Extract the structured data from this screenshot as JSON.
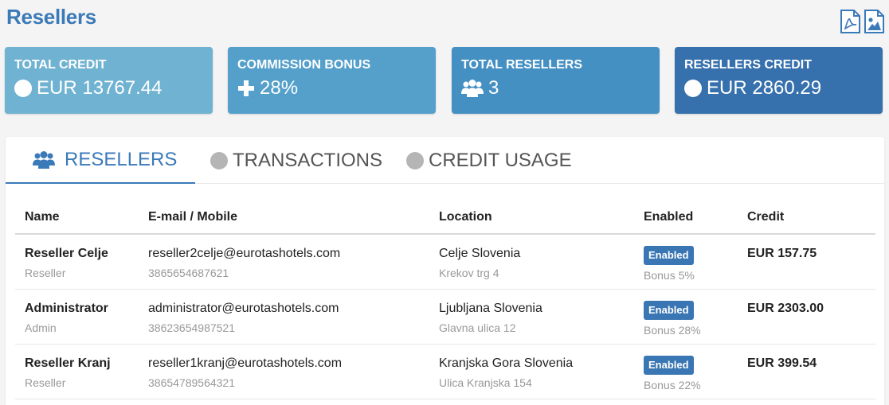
{
  "page": {
    "title": "Resellers"
  },
  "export": {
    "pdf_icon": "pdf-file-icon",
    "image_icon": "image-file-icon"
  },
  "colors": {
    "accent": "#3b7ab8",
    "badge": "#3a76b3",
    "muted": "#999999"
  },
  "cards": [
    {
      "title": "TOTAL CREDIT",
      "value": "EUR 13767.44",
      "icon": "circle-icon",
      "color": "#6fb2d2"
    },
    {
      "title": "COMMISSION BONUS",
      "value": "28%",
      "icon": "plus-icon",
      "color": "#55a0cb"
    },
    {
      "title": "TOTAL RESELLERS",
      "value": "3",
      "icon": "users-icon",
      "color": "#4590c3"
    },
    {
      "title": "RESELLERS CREDIT",
      "value": "EUR 2860.29",
      "icon": "circle-icon",
      "color": "#3670ad"
    }
  ],
  "tabs": [
    {
      "label": "RESELLERS",
      "icon": "users-icon",
      "active": true
    },
    {
      "label": "TRANSACTIONS",
      "icon": "circle-icon",
      "active": false
    },
    {
      "label": "CREDIT USAGE",
      "icon": "circle-icon",
      "active": false
    }
  ],
  "table": {
    "headers": [
      "Name",
      "E-mail / Mobile",
      "Location",
      "Enabled",
      "Credit"
    ],
    "rows": [
      {
        "name": "Reseller Celje",
        "role": "Reseller",
        "email": "reseller2celje@eurotashotels.com",
        "mobile": "3865654687621",
        "location": "Celje Slovenia",
        "address": "Krekov trg 4",
        "status": "Enabled",
        "bonus": "Bonus 5%",
        "credit": "EUR 157.75"
      },
      {
        "name": "Administrator",
        "role": "Admin",
        "email": "administrator@eurotashotels.com",
        "mobile": "38623654987521",
        "location": "Ljubljana Slovenia",
        "address": "Glavna ulica 12",
        "status": "Enabled",
        "bonus": "Bonus 28%",
        "credit": "EUR 2303.00"
      },
      {
        "name": "Reseller Kranj",
        "role": "Reseller",
        "email": "reseller1kranj@eurotashotels.com",
        "mobile": "38654789564321",
        "location": "Kranjska Gora Slovenia",
        "address": "Ulica Kranjska 154",
        "status": "Enabled",
        "bonus": "Bonus 22%",
        "credit": "EUR 399.54"
      }
    ]
  }
}
